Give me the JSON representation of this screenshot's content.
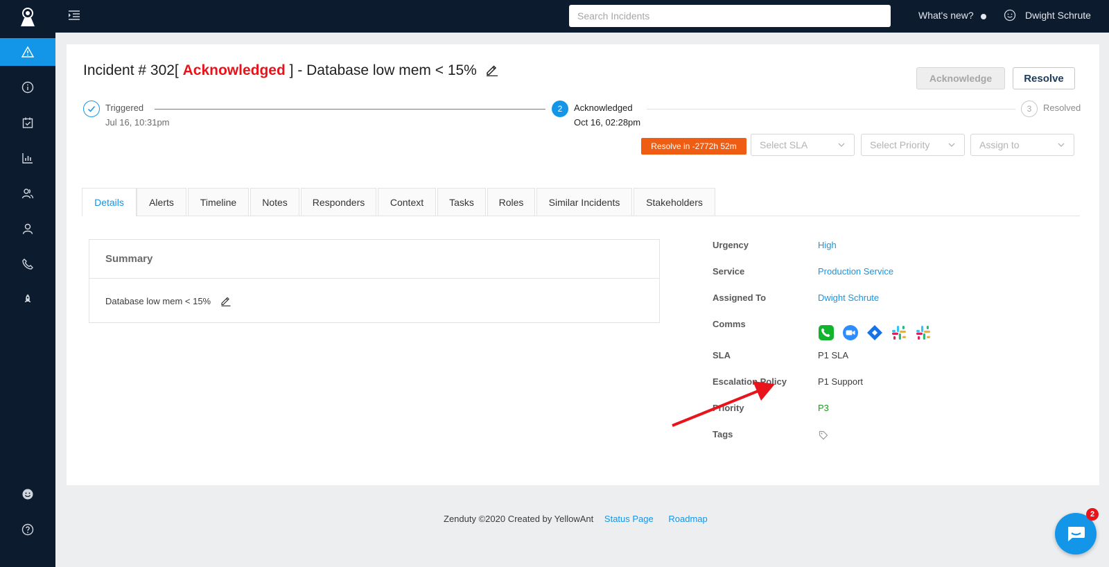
{
  "topbar": {
    "search_placeholder": "Search Incidents",
    "whats_new": "What's new?",
    "user_name": "Dwight Schrute"
  },
  "sidebar": {
    "items": [
      {
        "icon": "alert-triangle-icon",
        "active": true
      },
      {
        "icon": "info-icon"
      },
      {
        "icon": "calendar-check-icon"
      },
      {
        "icon": "bar-chart-icon"
      },
      {
        "icon": "users-icon"
      },
      {
        "icon": "user-icon"
      },
      {
        "icon": "phone-icon"
      },
      {
        "icon": "rocket-icon"
      },
      {
        "icon": "smiley-icon"
      },
      {
        "icon": "help-icon"
      }
    ]
  },
  "incident": {
    "title_prefix": "Incident # 302[ ",
    "status": "Acknowledged",
    "title_suffix": " ] - Database low mem < 15%"
  },
  "actions": {
    "acknowledge": "Acknowledge",
    "resolve": "Resolve"
  },
  "steps": [
    {
      "label": "Triggered",
      "date": "Jul 16, 10:31pm"
    },
    {
      "number": "2",
      "label": "Acknowledged",
      "date": "Oct 16, 02:28pm"
    },
    {
      "number": "3",
      "label": "Resolved"
    }
  ],
  "controls": {
    "resolve_in": "Resolve in -2772h 52m",
    "select_sla": "Select SLA",
    "select_priority": "Select Priority",
    "assign_to": "Assign to"
  },
  "tabs": [
    "Details",
    "Alerts",
    "Timeline",
    "Notes",
    "Responders",
    "Context",
    "Tasks",
    "Roles",
    "Similar Incidents",
    "Stakeholders"
  ],
  "summary": {
    "heading": "Summary",
    "text": "Database low mem < 15%"
  },
  "details": {
    "urgency_label": "Urgency",
    "urgency": "High",
    "service_label": "Service",
    "service": "Production Service",
    "assigned_label": "Assigned To",
    "assigned": "Dwight Schrute",
    "comms_label": "Comms",
    "sla_label": "SLA",
    "sla": "P1 SLA",
    "escalation_label": "Escalation Policy",
    "escalation": "P1 Support",
    "priority_label": "Priority",
    "priority": "P3",
    "tags_label": "Tags"
  },
  "comms_icons": [
    "phone-call-icon",
    "zoom-icon",
    "jira-icon",
    "slack-icon",
    "slack-icon"
  ],
  "footer": {
    "copyright": "Zenduty ©2020 Created by YellowAnt",
    "status_page": "Status Page",
    "roadmap": "Roadmap"
  },
  "chat": {
    "badge": "2"
  },
  "colors": {
    "sidebar_bg": "#0d1b2e",
    "accent": "#1396e8",
    "status_red": "#e8131b",
    "badge_orange": "#ef5d12"
  }
}
